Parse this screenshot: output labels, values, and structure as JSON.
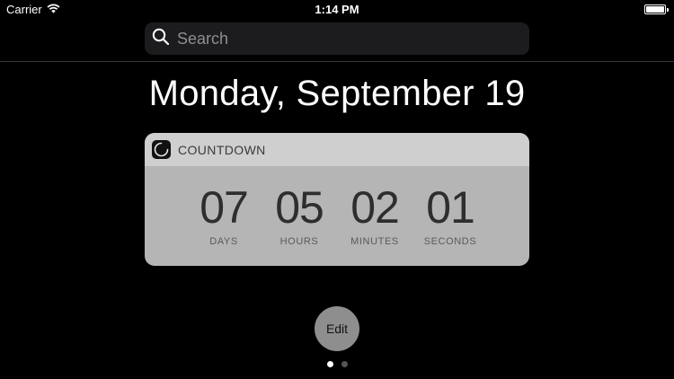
{
  "status_bar": {
    "carrier": "Carrier",
    "time": "1:14 PM",
    "battery_level": 1.0
  },
  "search": {
    "placeholder": "Search",
    "value": ""
  },
  "date_heading": "Monday, September 19",
  "widget": {
    "title": "COUNTDOWN",
    "icon": "countdown-app-icon",
    "units": [
      {
        "value": "07",
        "label": "DAYS"
      },
      {
        "value": "05",
        "label": "HOURS"
      },
      {
        "value": "02",
        "label": "MINUTES"
      },
      {
        "value": "01",
        "label": "SECONDS"
      }
    ]
  },
  "edit_label": "Edit",
  "page_indicator": {
    "count": 2,
    "current": 1
  },
  "colors": {
    "background": "#000000",
    "search_bg": "#1c1c1e",
    "widget_header": "#cfcfcf",
    "widget_body": "#b5b5b5",
    "edit_button": "#8e8e8e"
  }
}
